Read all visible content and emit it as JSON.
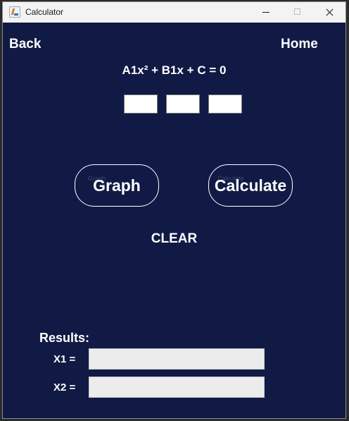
{
  "window": {
    "title": "Calculator",
    "icon": "java-app-icon"
  },
  "nav": {
    "back_label": "Back",
    "home_label": "Home"
  },
  "equation": "A1x² + B1x + C = 0",
  "coefficients": {
    "a_value": "",
    "b_value": "",
    "c_value": ""
  },
  "buttons": {
    "graph_label": "Graph",
    "graph_ghost": "Graph",
    "calculate_label": "Calculate",
    "calculate_ghost": "Calculate",
    "clear_label": "CLEAR"
  },
  "results": {
    "title": "Results:",
    "x1_label": "X1 =",
    "x1_value": "",
    "x2_label": "X2 =",
    "x2_value": ""
  },
  "colors": {
    "background": "#101a45",
    "text": "#ffffff",
    "titlebar": "#f3f3f3",
    "result_field": "#ececec"
  }
}
